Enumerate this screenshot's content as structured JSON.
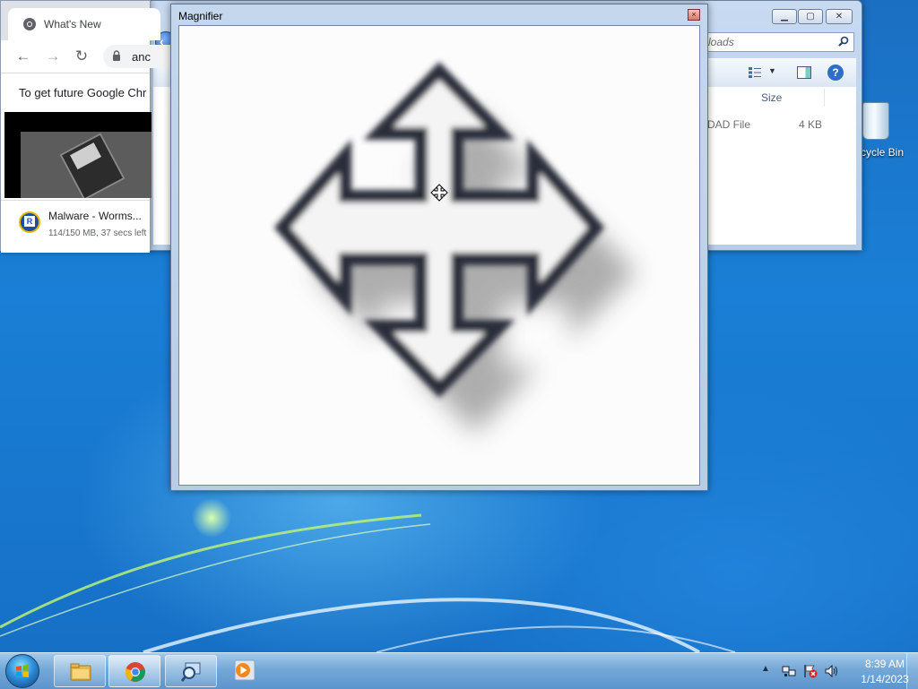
{
  "chrome": {
    "tab_title": "What's New",
    "url": "anc",
    "notice": "To get future Google Chr",
    "download": {
      "name": "Malware - Worms...",
      "status": "114/150 MB, 37 secs left"
    }
  },
  "explorer": {
    "search_placeholder": "loads",
    "column_size": "Size",
    "file": {
      "type": "DAD File",
      "size": "4 KB"
    },
    "help_glyph": "?"
  },
  "magnifier": {
    "title": "Magnifier",
    "close_glyph": "×"
  },
  "desktop": {
    "recycle_bin_label": "cycle Bin"
  },
  "taskbar": {
    "time": "8:39 AM",
    "date": "1/14/2023",
    "tray_arrow": "▲"
  },
  "icons": [
    "chrome-icon",
    "lock-icon",
    "back-arrow-icon",
    "forward-arrow-icon",
    "reload-icon",
    "search-icon",
    "views-icon",
    "preview-pane-icon",
    "help-icon",
    "recycle-bin-icon",
    "move-cursor-icon",
    "windows-flag-icon",
    "folder-icon",
    "magnifier-icon",
    "media-player-icon",
    "network-icon",
    "action-center-icon",
    "volume-icon"
  ],
  "colors": {
    "desktop_blue": "#1a74c8",
    "taskbar": "#78aad7",
    "chrome_tabbar": "#dee1e6"
  }
}
